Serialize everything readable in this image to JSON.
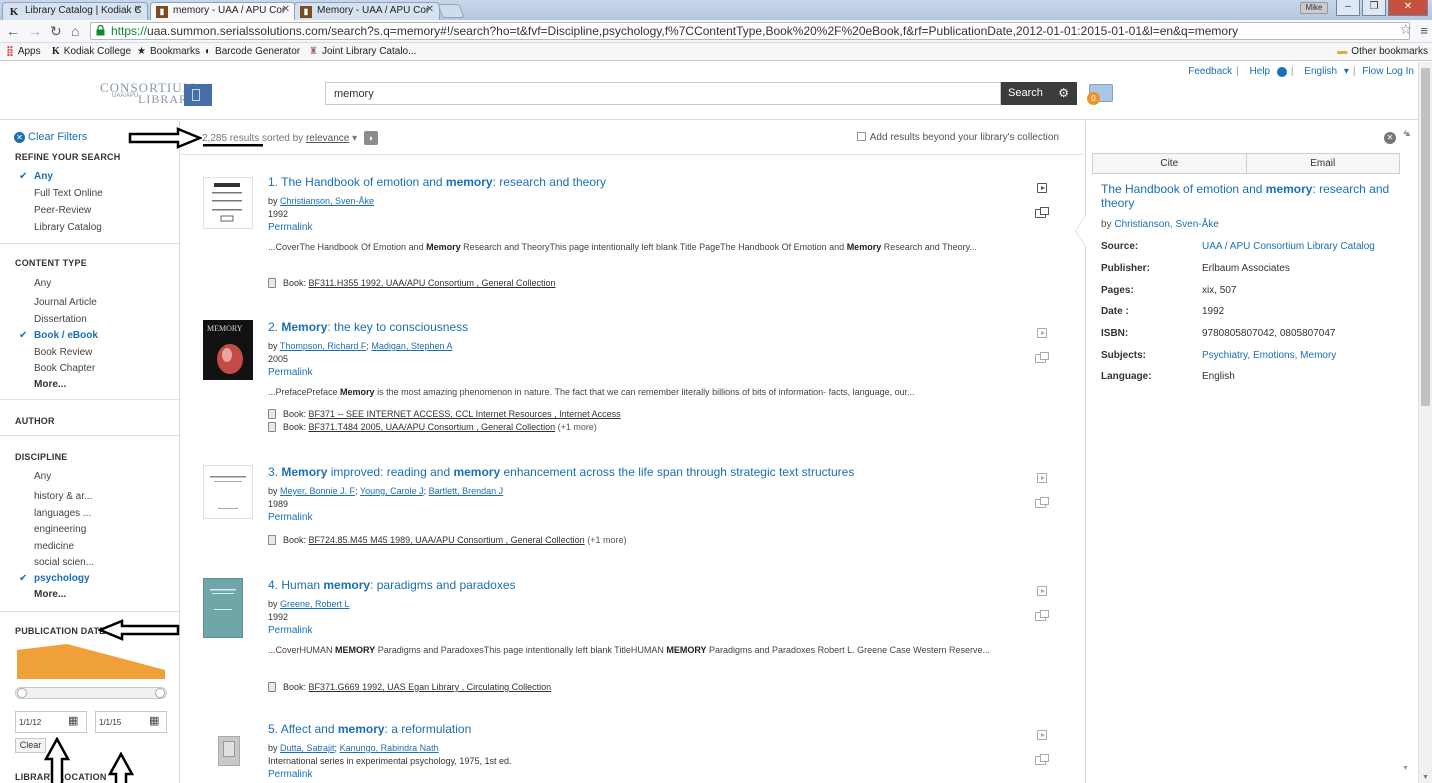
{
  "browser": {
    "tabs": [
      {
        "title": "Library Catalog | Kodiak C",
        "icon": "K"
      },
      {
        "title": "memory - UAA / APU Cor",
        "icon": "book"
      },
      {
        "title": "Memory - UAA / APU Cor",
        "icon": "book"
      }
    ],
    "user_badge": "Mike",
    "url_scheme": "https://",
    "url_rest": "uaa.summon.serialssolutions.com/search?s.q=memory#!/search?ho=t&fvf=Discipline,psychology,f%7CContentType,Book%20%2F%20eBook,f&rf=PublicationDate,2012-01-01:2015-01-01&l=en&q=memory",
    "bookmarks": [
      {
        "label": "Apps",
        "icon": "grid"
      },
      {
        "label": "Kodiak College",
        "icon": "K"
      },
      {
        "label": "Bookmarks",
        "icon": "star"
      },
      {
        "label": "Barcode Generator",
        "icon": "circle"
      },
      {
        "label": "Joint Library Catalo...",
        "icon": "tower"
      }
    ],
    "other_bookmarks": "Other bookmarks"
  },
  "header": {
    "logo_line1": "CONSORTIUM",
    "logo_line2": "UAA/APU",
    "logo_line3": "LIBRARY",
    "search_value": "memory",
    "search_button": "Search",
    "saved_count": "0",
    "links": {
      "feedback": "Feedback",
      "help": "Help",
      "language": "English",
      "login": "Flow Log In"
    }
  },
  "sidebar": {
    "clear_filters": "Clear Filters",
    "refine_title": "REFINE YOUR SEARCH",
    "refine_items": [
      "Any",
      "Full Text Online",
      "Peer-Review",
      "Library Catalog"
    ],
    "content_type_title": "CONTENT TYPE",
    "content_type_items": [
      "Any",
      "Journal Article",
      "Dissertation",
      "Book / eBook",
      "Book Review",
      "Book Chapter"
    ],
    "more": "More...",
    "author_title": "AUTHOR",
    "discipline_title": "DISCIPLINE",
    "discipline_items": [
      "Any",
      "history & ar...",
      "languages ...",
      "engineering",
      "medicine",
      "social scien...",
      "psychology"
    ],
    "pubdate_title": "PUBLICATION DATE",
    "date_from": "1/1/12",
    "date_to": "1/1/15",
    "clear_button": "Clear",
    "library_location_title": "LIBRARY LOCATION"
  },
  "results_bar": {
    "count": "2,285 results",
    "sorted_by": "sorted by",
    "sort": "relevance",
    "beyond": "Add results beyond your library's collection"
  },
  "results": [
    {
      "num": "1.",
      "title_parts": [
        [
          "The Handbook of emotion and ",
          false
        ],
        [
          "memory",
          true
        ],
        [
          ": research and theory",
          false
        ]
      ],
      "authors": [
        "Christianson, Sven-Åke"
      ],
      "year": "1992",
      "permalink": "Permalink",
      "snippet_parts": [
        [
          "...CoverThe Handbook Of Emotion and ",
          false
        ],
        [
          "Memory",
          true
        ],
        [
          " Research and TheoryThis page intentionally left blank Title PageThe Handbook Of Emotion and ",
          false
        ],
        [
          "Memory",
          true
        ],
        [
          " Research and Theory...",
          false
        ]
      ],
      "holdings": [
        {
          "label": "Book:",
          "callno": "BF311.H355 1992, UAA/APU Consortium , General Collection",
          "extra": ""
        }
      ]
    },
    {
      "num": "2.",
      "title_parts": [
        [
          "Memory",
          true
        ],
        [
          ": the key to consciousness",
          false
        ]
      ],
      "authors": [
        "Thompson, Richard F",
        "Madigan, Stephen A"
      ],
      "year": "2005",
      "permalink": "Permalink",
      "snippet_parts": [
        [
          "...PrefacePreface ",
          false
        ],
        [
          "Memory",
          true
        ],
        [
          " is the most amazing phenomenon in nature. The fact that we can remember literally billions of bits of information- facts, language, our...",
          false
        ]
      ],
      "holdings": [
        {
          "label": "Book:",
          "callno": "BF371 -- SEE INTERNET ACCESS, CCL Internet Resources , Internet Access",
          "extra": ""
        },
        {
          "label": "Book:",
          "callno": "BF371.T484 2005, UAA/APU Consortium , General Collection",
          "extra": "(+1 more)"
        }
      ]
    },
    {
      "num": "3.",
      "title_parts": [
        [
          "Memory",
          true
        ],
        [
          " improved: reading and ",
          false
        ],
        [
          "memory",
          true
        ],
        [
          " enhancement across the life span through strategic text structures",
          false
        ]
      ],
      "authors": [
        "Meyer, Bonnie J. F",
        "Young, Carole J",
        "Bartlett, Brendan J"
      ],
      "year": "1989",
      "permalink": "Permalink",
      "snippet_parts": [],
      "holdings": [
        {
          "label": "Book:",
          "callno": "BF724.85.M45 M45 1989, UAA/APU Consortium , General Collection",
          "extra": "(+1 more)"
        }
      ]
    },
    {
      "num": "4.",
      "title_parts": [
        [
          "Human ",
          false
        ],
        [
          "memory",
          true
        ],
        [
          ": paradigms and paradoxes",
          false
        ]
      ],
      "authors": [
        "Greene, Robert L"
      ],
      "year": "1992",
      "permalink": "Permalink",
      "snippet_parts": [
        [
          "...CoverHUMAN ",
          false
        ],
        [
          "MEMORY",
          true
        ],
        [
          " Paradigms and ParadoxesThis page intentionally left blank TitleHUMAN ",
          false
        ],
        [
          "MEMORY",
          true
        ],
        [
          " Paradigms and Paradoxes Robert L. Greene Case Western Reserve...",
          false
        ]
      ],
      "holdings": [
        {
          "label": "Book:",
          "callno": "BF371.G669 1992, UAS Egan Library , Circulating Collection",
          "extra": ""
        }
      ]
    },
    {
      "num": "5.",
      "title_parts": [
        [
          "Affect and ",
          false
        ],
        [
          "memory",
          true
        ],
        [
          ": a reformulation",
          false
        ]
      ],
      "authors": [
        "Dutta, Satrajit",
        "Kanungo, Rabindra Nath"
      ],
      "year": "International series in experimental psychology, 1975, 1st ed.",
      "permalink": "Permalink",
      "snippet_parts": [],
      "holdings": []
    }
  ],
  "detail": {
    "cite": "Cite",
    "email": "Email",
    "title_parts": [
      [
        "The Handbook of emotion and ",
        false
      ],
      [
        "memory",
        true
      ],
      [
        ": research and theory",
        false
      ]
    ],
    "by_label": "by",
    "author": "Christianson, Sven-Åke",
    "fields": [
      {
        "label": "Source:",
        "value": "UAA / APU Consortium Library Catalog",
        "link": true
      },
      {
        "label": "Publisher:",
        "value": "Erlbaum Associates",
        "link": false
      },
      {
        "label": "Pages:",
        "value": "xix, 507",
        "link": false
      },
      {
        "label": "Date :",
        "value": "1992",
        "link": false
      },
      {
        "label": "ISBN:",
        "value": "9780805807042, 0805807047",
        "link": false
      },
      {
        "label": "Subjects:",
        "value": "Psychiatry, Emotions, Memory",
        "link": true
      },
      {
        "label": "Language:",
        "value": "English",
        "link": false
      }
    ]
  },
  "colors": {
    "link": "#1a6fb5",
    "chart_fill": "#f0a038",
    "search_button": "#3c3c3c",
    "badge": "#f0922b"
  }
}
